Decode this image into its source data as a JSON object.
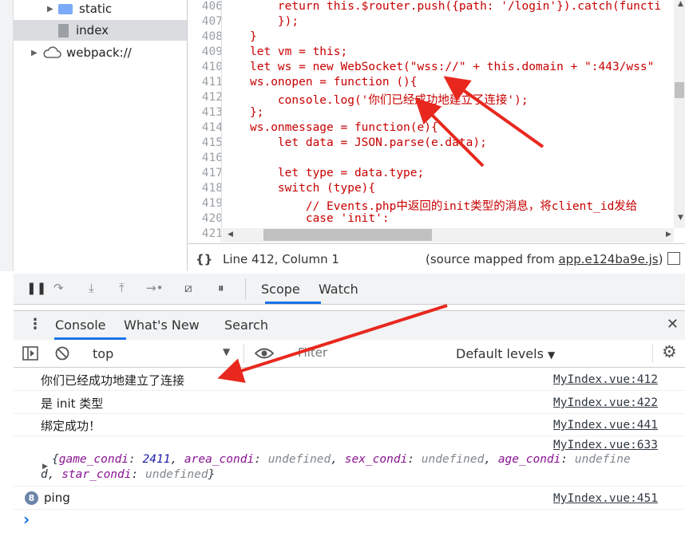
{
  "file_tree": {
    "items": [
      {
        "name": "static",
        "type": "folder",
        "expanded": false
      },
      {
        "name": "index",
        "type": "file",
        "selected": true
      },
      {
        "name": "webpack://",
        "type": "cloud",
        "expanded": false
      }
    ]
  },
  "editor": {
    "lines": [
      {
        "n": "406",
        "code": "    return this.$router.push({path: '/login'}).catch(functi"
      },
      {
        "n": "407",
        "code": "    });"
      },
      {
        "n": "408",
        "code": "}"
      },
      {
        "n": "409",
        "code": "let vm = this;"
      },
      {
        "n": "410",
        "code": "let ws = new WebSocket(\"wss://\" + this.domain + \":443/wss\""
      },
      {
        "n": "411",
        "code": "ws.onopen = function (){"
      },
      {
        "n": "412",
        "code": "    console.log('你们已经成功地建立了连接');"
      },
      {
        "n": "413",
        "code": "};"
      },
      {
        "n": "414",
        "code": "ws.onmessage = function(e){"
      },
      {
        "n": "415",
        "code": "    let data = JSON.parse(e.data);"
      },
      {
        "n": "416",
        "code": ""
      },
      {
        "n": "417",
        "code": "    let type = data.type;"
      },
      {
        "n": "418",
        "code": "    switch (type){"
      },
      {
        "n": "419",
        "code": "        // Events.php中返回的init类型的消息，将client_id发给"
      },
      {
        "n": "420",
        "code": "        case 'init':"
      },
      {
        "n": "421",
        "code": ""
      }
    ]
  },
  "status_bar": {
    "braces": "{}",
    "position": "Line 412, Column 1",
    "source_prefix": "(source mapped from ",
    "source_link": "app.e124ba9e.js",
    "source_suffix": ")"
  },
  "debugger": {
    "tabs": [
      "Scope",
      "Watch"
    ],
    "active_tab": "Scope"
  },
  "drawer": {
    "tabs": [
      "Console",
      "What's New",
      "Search"
    ],
    "active_tab": "Console",
    "close": "✕"
  },
  "console_toolbar": {
    "context": "top",
    "filter_placeholder": "Filter",
    "levels": "Default levels"
  },
  "messages": [
    {
      "text": "你们已经成功地建立了连接",
      "source": "MyIndex.vue:412"
    },
    {
      "text": "是 init 类型",
      "source": "MyIndex.vue:422"
    },
    {
      "text": "绑定成功！",
      "source": "MyIndex.vue:441"
    },
    {
      "source": "MyIndex.vue:633",
      "object_line1": [
        "{",
        "game_condi",
        ": ",
        "2411",
        ", ",
        "area_condi",
        ": ",
        "undefined",
        ", ",
        "sex_condi",
        ": ",
        "undefined",
        ", ",
        "age_condi",
        ": ",
        "undefine"
      ],
      "object_line2": [
        "d",
        ", ",
        "star_condi",
        ": ",
        "undefined",
        "}"
      ]
    },
    {
      "badge": "8",
      "text": "ping",
      "source": "MyIndex.vue:451"
    }
  ],
  "prompt": "›",
  "colors": {
    "accent": "#1a73e8",
    "code": "#c80000",
    "annotation": "#e8281e"
  }
}
